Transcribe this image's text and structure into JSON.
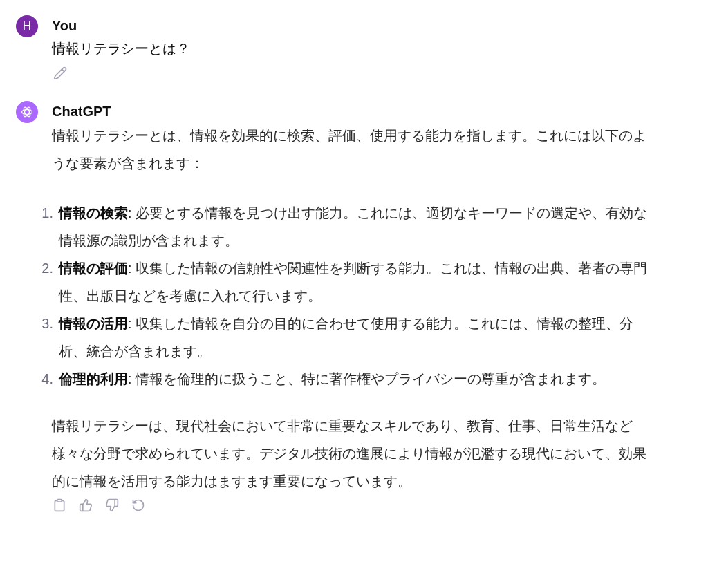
{
  "user_message": {
    "avatar_letter": "H",
    "author": "You",
    "text": "情報リテラシーとは？"
  },
  "assistant_message": {
    "author": "ChatGPT",
    "intro": "情報リテラシーとは、情報を効果的に検索、評価、使用する能力を指します。これには以下のような要素が含まれます：",
    "list": [
      {
        "number": "1.",
        "term": "情報の検索",
        "text": ": 必要とする情報を見つけ出す能力。これには、適切なキーワードの選定や、有効な情報源の識別が含まれます。"
      },
      {
        "number": "2.",
        "term": "情報の評価",
        "text": ": 収集した情報の信頼性や関連性を判断する能力。これは、情報の出典、著者の専門性、出版日などを考慮に入れて行います。"
      },
      {
        "number": "3.",
        "term": "情報の活用",
        "text": ": 収集した情報を自分の目的に合わせて使用する能力。これには、情報の整理、分析、統合が含まれます。"
      },
      {
        "number": "4.",
        "term": "倫理的利用",
        "text": ": 情報を倫理的に扱うこと、特に著作権やプライバシーの尊重が含まれます。"
      }
    ],
    "conclusion": "情報リテラシーは、現代社会において非常に重要なスキルであり、教育、仕事、日常生活など様々な分野で求められています。デジタル技術の進展により情報が氾濫する現代において、効果的に情報を活用する能力はますます重要になっています。"
  }
}
